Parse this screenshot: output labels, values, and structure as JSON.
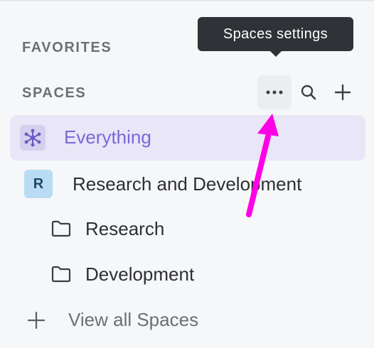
{
  "sidebar": {
    "favorites_label": "FAVORITES",
    "spaces_label": "SPACES",
    "tooltip": "Spaces settings",
    "actions": {
      "more_icon": "more-horizontal-icon",
      "search_icon": "search-icon",
      "add_icon": "plus-icon"
    },
    "items": [
      {
        "label": "Everything",
        "icon": "everything-icon",
        "selected": true
      },
      {
        "label": "Research and Development",
        "avatar": "R"
      },
      {
        "label": "Research",
        "icon": "folder-icon"
      },
      {
        "label": "Development",
        "icon": "folder-icon"
      }
    ],
    "view_all": "View all Spaces"
  },
  "colors": {
    "accent": "#7b68d6",
    "selected_bg": "#e8e6f7",
    "annotation": "#ff00e6",
    "tooltip_bg": "#2f3337",
    "avatar_bg": "#b9dbf3"
  }
}
